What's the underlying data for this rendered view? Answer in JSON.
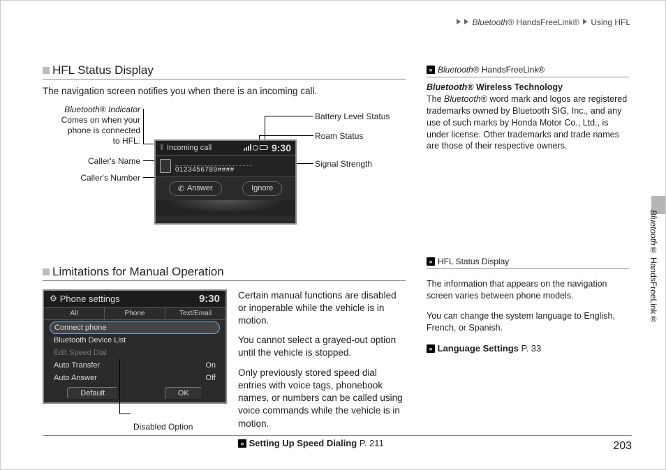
{
  "breadcrumb": {
    "seg1_em": "Bluetooth",
    "seg1_sym": "®",
    "seg1_rest": " HandsFreeLink®",
    "seg2": "Using HFL"
  },
  "section1": {
    "heading": "HFL Status Display",
    "intro": "The navigation screen notifies you when there is an incoming call.",
    "callouts": {
      "bt_indicator_l1": "Bluetooth® Indicator",
      "bt_indicator_l2": "Comes on when your",
      "bt_indicator_l3": "phone is connected",
      "bt_indicator_l4": "to HFL.",
      "caller_name": "Caller's Name",
      "caller_number": "Caller's Number",
      "battery": "Battery Level Status",
      "roam": "Roam Status",
      "signal": "Signal Strength"
    },
    "shot": {
      "title": "Incoming call",
      "time": "9:30",
      "number": "0123456789####",
      "answer": "Answer",
      "ignore": "Ignore"
    }
  },
  "section2": {
    "heading": "Limitations for Manual Operation",
    "shot": {
      "title": "Phone settings",
      "time": "9:30",
      "tabs": {
        "all": "All",
        "phone": "Phone",
        "text": "Text/Email"
      },
      "items": {
        "connect": "Connect phone",
        "bdl": "Bluetooth Device List",
        "esd": "Edit Speed Dial",
        "at": "Auto Transfer",
        "at_val": "On",
        "aa": "Auto Answer",
        "aa_val": "Off"
      },
      "buttons": {
        "default": "Default",
        "ok": "OK"
      }
    },
    "disabled_callout": "Disabled Option",
    "paras": {
      "p1": "Certain manual functions are disabled or inoperable while the vehicle is in motion.",
      "p2": "You cannot select a grayed-out option until the vehicle is stopped.",
      "p3": "Only previously stored speed dial entries with voice tags, phonebook names, or numbers can be called using voice commands while the vehicle is in motion."
    },
    "ref": {
      "label": "Setting Up Speed Dialing",
      "page": "P. 211"
    }
  },
  "sidebar": {
    "block1": {
      "head_em": "Bluetooth",
      "head_rest": "® HandsFreeLink®",
      "title_em": "Bluetooth",
      "title_rest": "® Wireless Technology",
      "body_pre": "The ",
      "body_em": "Bluetooth",
      "body_post": "® word mark and logos are registered trademarks owned by Bluetooth SIG, Inc., and any use of such marks by Honda Motor Co., Ltd., is under license. Other trademarks and trade names are those of their respective owners."
    },
    "block2": {
      "head": "HFL Status Display",
      "p1": "The information that appears on the navigation screen varies between phone models.",
      "p2": "You can change the system language to English, French, or Spanish.",
      "ref_label": "Language Settings",
      "ref_page": "P. 33"
    }
  },
  "sidetab": {
    "em": "Bluetooth",
    "rest": "® HandsFreeLink®"
  },
  "page_number": "203"
}
